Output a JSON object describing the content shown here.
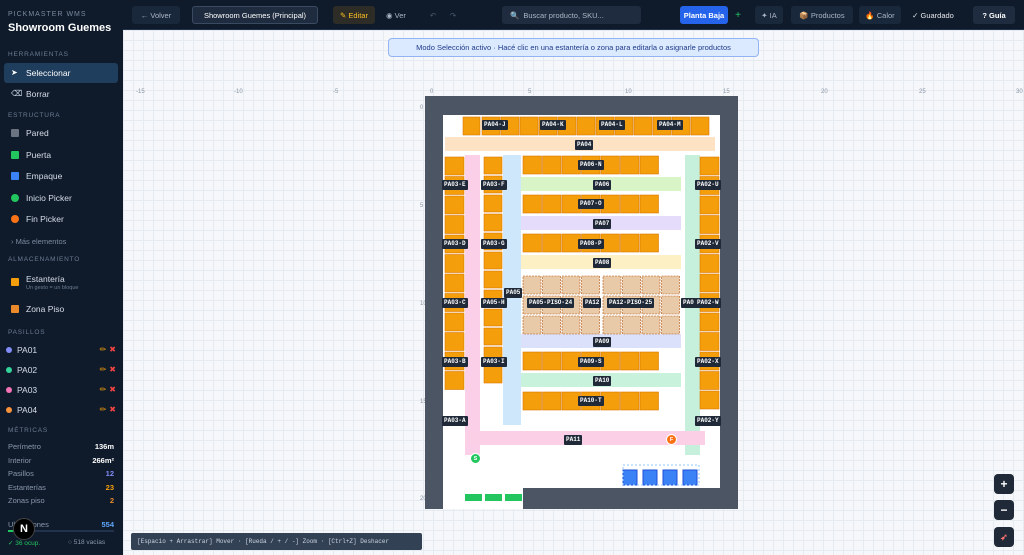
{
  "brand": {
    "subtitle": "PICKMASTER WMS",
    "title": "Showroom Guemes"
  },
  "sections": {
    "tools": "HERRAMIENTAS",
    "structure": "ESTRUCTURA",
    "storage": "ALMACENAMIENTO",
    "aisles": "PASILLOS",
    "metrics": "MÉTRICAS"
  },
  "tools": [
    {
      "label": "Seleccionar",
      "icon": "cursor-icon"
    },
    {
      "label": "Borrar",
      "icon": "eraser-icon"
    }
  ],
  "structure": [
    {
      "label": "Pared",
      "color": "#6b7280"
    },
    {
      "label": "Puerta",
      "color": "#22c55e"
    },
    {
      "label": "Empaque",
      "color": "#3b82f6"
    },
    {
      "label": "Inicio Picker",
      "color": "#22c55e"
    },
    {
      "label": "Fin Picker",
      "color": "#f97316"
    }
  ],
  "more_elements": "› Más elementos",
  "storage": [
    {
      "label": "Estantería",
      "hint": "Un gesto = un bloque",
      "color": "#f59e0b"
    },
    {
      "label": "Zona Piso",
      "color": "#ea8a2a"
    }
  ],
  "aisles": [
    {
      "label": "PA01",
      "color": "#818cf8"
    },
    {
      "label": "PA02",
      "color": "#34d399"
    },
    {
      "label": "PA03",
      "color": "#f472b6"
    },
    {
      "label": "PA04",
      "color": "#fb923c"
    }
  ],
  "metrics": [
    {
      "label": "Perímetro",
      "value": "136m"
    },
    {
      "label": "Interior",
      "value": "266m²"
    },
    {
      "label": "Pasillos",
      "value": "12"
    },
    {
      "label": "Estanterías",
      "value": "23"
    },
    {
      "label": "Zonas piso",
      "value": "2"
    },
    {
      "label": "Ubicaciones",
      "value": "554"
    }
  ],
  "occupancy": {
    "occupied": "✓ 36 ocup.",
    "empty": "○ 518 vacías"
  },
  "topbar": {
    "back": "← Volver",
    "layout_select": "Showroom Guemes (Principal)",
    "edit": "✎ Editar",
    "view": "◉ Ver",
    "search_placeholder": "Buscar producto, SKU...",
    "floor": "Planta Baja",
    "add": "+",
    "ai": "✦ IA",
    "products": "📦 Productos",
    "heat": "🔥 Calor",
    "saved": "✓ Guardado",
    "guide": "? Guía"
  },
  "banner": "Modo Selección activo · Hacé clic en una estantería o zona para editarla o asignarle productos",
  "ruler_top": [
    "-15",
    "-10",
    "-5",
    "0",
    "5",
    "10",
    "15",
    "20",
    "25",
    "30"
  ],
  "ruler_left": [
    "0",
    "5",
    "10",
    "15",
    "20"
  ],
  "map_labels": [
    "PA04-J",
    "PA04-K",
    "PA04-L",
    "PA04-M",
    "PA04",
    "PA06-N",
    "PA03-E",
    "PA03-F",
    "PA06",
    "PA02-U",
    "PA07-O",
    "PA07",
    "PA03-D",
    "PA03-G",
    "PA08-P",
    "PA02-V",
    "PA08",
    "PA05",
    "PA03-C",
    "PA05-H",
    "PA05-PISO-24",
    "PA12",
    "PA12-PISO-25",
    "PA0",
    "PA02-W",
    "PA09",
    "PA03-B",
    "PA03-I",
    "PA09-S",
    "PA02-X",
    "PA10",
    "PA10-T",
    "PA03-A",
    "PA02-Y",
    "PA11",
    "S",
    "F"
  ],
  "zoom": {
    "in": "+",
    "out": "−"
  },
  "statusbar": "[Espacio + Arrastrar] Mover · [Rueda / + / -] Zoom · [Ctrl+Z] Deshacer"
}
